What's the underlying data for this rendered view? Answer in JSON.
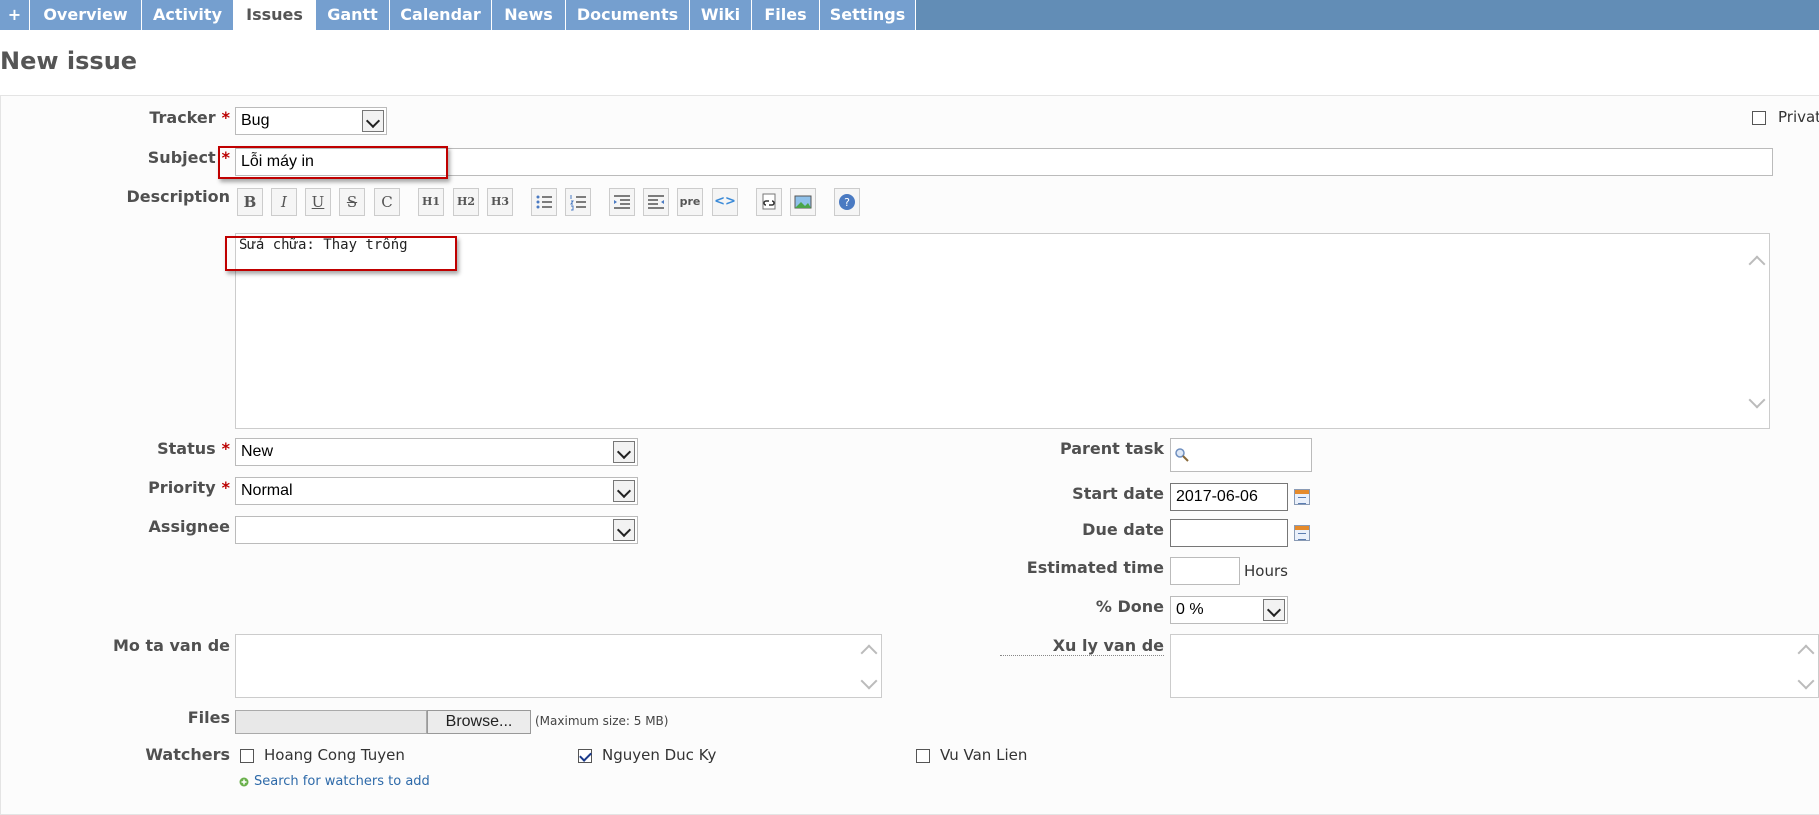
{
  "tabs": [
    {
      "label": "+"
    },
    {
      "label": "Overview"
    },
    {
      "label": "Activity"
    },
    {
      "label": "Issues"
    },
    {
      "label": "Gantt"
    },
    {
      "label": "Calendar"
    },
    {
      "label": "News"
    },
    {
      "label": "Documents"
    },
    {
      "label": "Wiki"
    },
    {
      "label": "Files"
    },
    {
      "label": "Settings"
    }
  ],
  "selected_tab": "Issues",
  "page_title": "New issue",
  "form": {
    "tracker_label": "Tracker",
    "tracker_value": "Bug",
    "private_label": "Privat",
    "subject_label": "Subject",
    "subject_value": "Lỗi máy in",
    "description_label": "Description",
    "description_value": "Sửa chữa: Thay trống",
    "toolbar": {
      "bold": "B",
      "italic": "I",
      "underline": "U",
      "strike": "S",
      "code": "C",
      "h1": "H1",
      "h2": "H2",
      "h3": "H3",
      "pre": "pre"
    },
    "status_label": "Status",
    "status_value": "New",
    "priority_label": "Priority",
    "priority_value": "Normal",
    "assignee_label": "Assignee",
    "assignee_value": "",
    "parent_task_label": "Parent task",
    "start_date_label": "Start date",
    "start_date_value": "2017-06-06",
    "due_date_label": "Due date",
    "due_date_value": "",
    "estimated_time_label": "Estimated time",
    "hours_label": "Hours",
    "done_label": "% Done",
    "done_value": "0 %",
    "mo_ta_label": "Mo ta van de",
    "xu_ly_label": "Xu ly van de",
    "files_label": "Files",
    "browse_label": "Browse...",
    "max_size": "(Maximum size: 5 MB)",
    "watchers_label": "Watchers",
    "watchers": [
      {
        "name": "Hoang Cong Tuyen",
        "checked": false
      },
      {
        "name": "Nguyen Duc Ky",
        "checked": true
      },
      {
        "name": "Vu Van Lien",
        "checked": false
      }
    ],
    "search_watchers": "Search for watchers to add"
  }
}
